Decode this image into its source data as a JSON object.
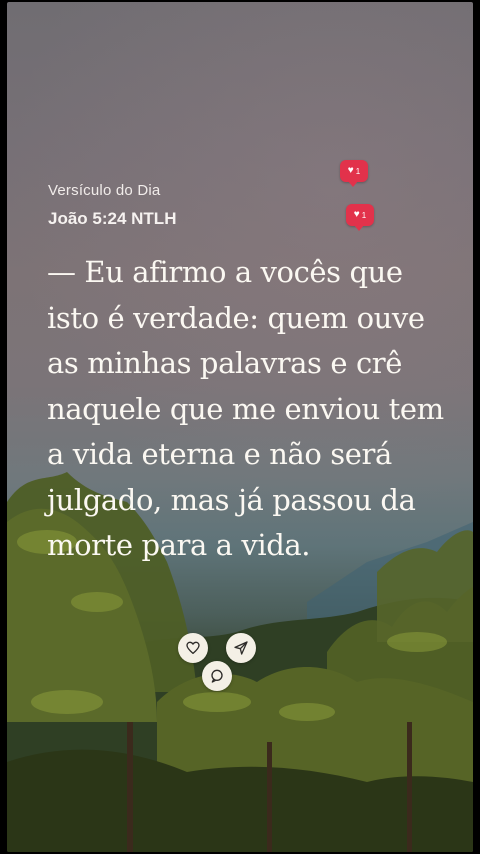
{
  "verse_card": {
    "overline": "Versículo do Dia",
    "reference": "João 5:24 NTLH",
    "text": " — Eu afirmo a vocês que isto é verdade: quem ouve as minhas palavras e crê naquele que me enviou tem a vida eterna e não será julgado, mas já passou da morte para a vida."
  },
  "reactions": [
    {
      "icon": "heart-icon",
      "count": "1"
    },
    {
      "icon": "heart-icon",
      "count": "1"
    }
  ],
  "actions": [
    {
      "name": "like",
      "icon": "heart-outline-icon"
    },
    {
      "name": "share",
      "icon": "send-icon"
    },
    {
      "name": "comment",
      "icon": "comment-icon"
    }
  ],
  "colors": {
    "badge": "#e2324b",
    "button_bg": "#f4f0e6",
    "text": "#fbf8f2"
  }
}
